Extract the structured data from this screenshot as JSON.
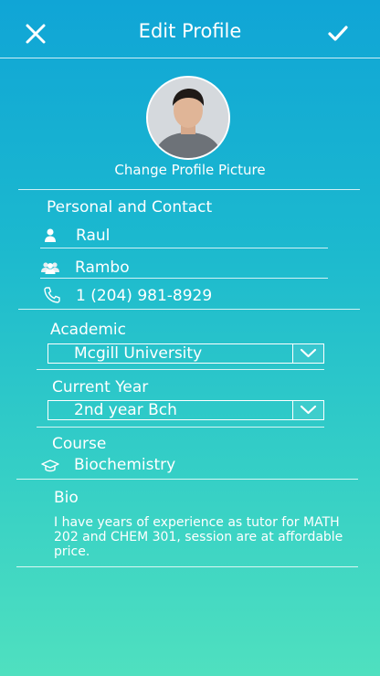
{
  "header": {
    "title": "Edit Profile",
    "close_icon": "close-icon",
    "confirm_icon": "check-icon"
  },
  "profile": {
    "change_picture_label": "Change Profile Picture"
  },
  "personal": {
    "section_label": "Personal and Contact",
    "first_name": "Raul",
    "last_name": "Rambo",
    "phone": "1 (204) 981-8929"
  },
  "academic": {
    "section_label": "Academic",
    "university": "Mcgill University",
    "year_label": "Current Year",
    "year": "2nd year Bch",
    "course_label": "Course",
    "course": "Biochemistry"
  },
  "bio": {
    "label": "Bio",
    "text": "I have years of experience as tutor for MATH 202 and CHEM 301, session are at affordable price."
  },
  "colors": {
    "gradient_top": "#10a5d6",
    "gradient_bottom": "#4fe0bf",
    "text": "#ffffff"
  }
}
